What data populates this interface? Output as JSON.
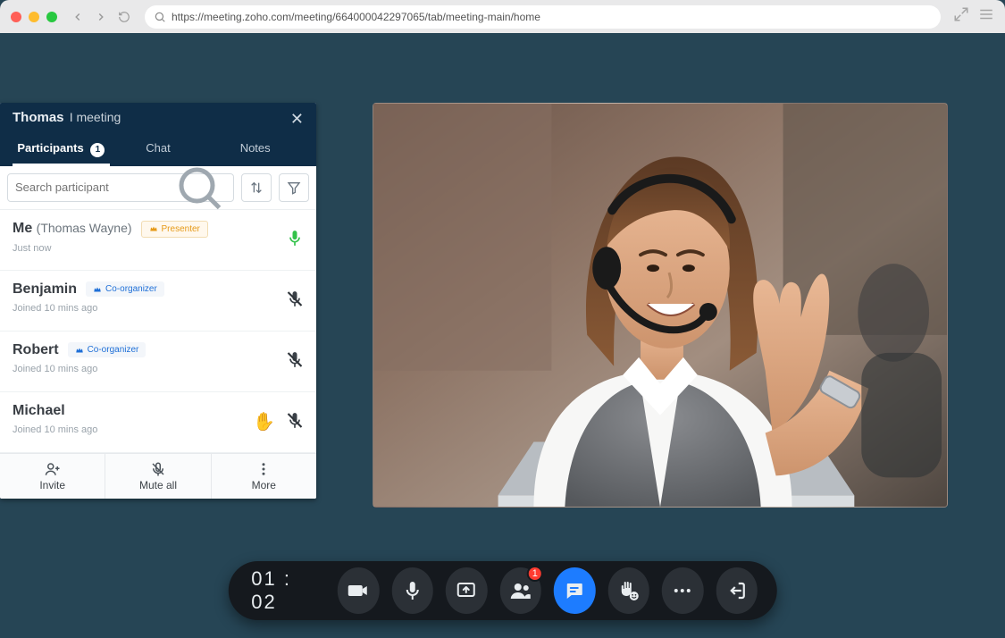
{
  "browser": {
    "url": "https://meeting.zoho.com/meeting/664000042297065/tab/meeting-main/home"
  },
  "panel": {
    "title_name": "Thomas",
    "title_suffix": "I meeting",
    "tabs": {
      "participants": "Participants",
      "participants_count": "1",
      "chat": "Chat",
      "notes": "Notes"
    },
    "search": {
      "placeholder": "Search participant"
    },
    "participants": [
      {
        "name": "Me",
        "name_meta": "(Thomas Wayne)",
        "role": "Presenter",
        "role_type": "presenter",
        "joined": "Just now",
        "mic": "on",
        "hand": false
      },
      {
        "name": "Benjamin",
        "name_meta": "",
        "role": "Co-organizer",
        "role_type": "coorganizer",
        "joined": "Joined 10 mins ago",
        "mic": "muted",
        "hand": false
      },
      {
        "name": "Robert",
        "name_meta": "",
        "role": "Co-organizer",
        "role_type": "coorganizer",
        "joined": "Joined 10 mins ago",
        "mic": "muted",
        "hand": false
      },
      {
        "name": "Michael",
        "name_meta": "",
        "role": "",
        "role_type": "",
        "joined": "Joined 10 mins ago",
        "mic": "muted",
        "hand": true
      }
    ],
    "actions": {
      "invite": "Invite",
      "mute_all": "Mute all",
      "more": "More"
    }
  },
  "toolbar": {
    "timer": "01 : 02",
    "participants_badge": "1"
  }
}
